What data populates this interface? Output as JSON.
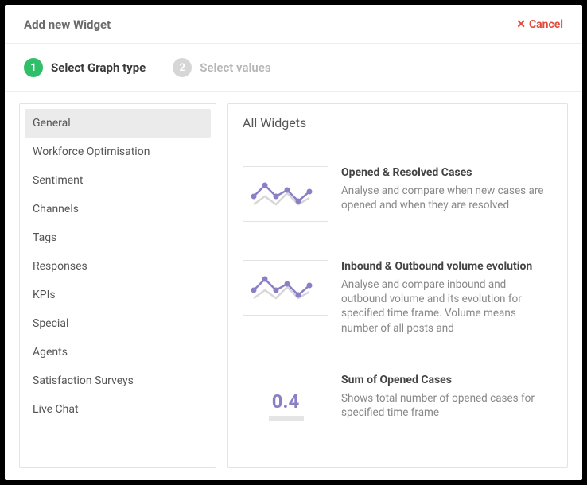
{
  "header": {
    "title": "Add new Widget",
    "cancel": "Cancel"
  },
  "steps": [
    {
      "num": "1",
      "label": "Select Graph type",
      "active": true
    },
    {
      "num": "2",
      "label": "Select values",
      "active": false
    }
  ],
  "sidebar": {
    "items": [
      {
        "label": "General",
        "selected": true
      },
      {
        "label": "Workforce Optimisation",
        "selected": false
      },
      {
        "label": "Sentiment",
        "selected": false
      },
      {
        "label": "Channels",
        "selected": false
      },
      {
        "label": "Tags",
        "selected": false
      },
      {
        "label": "Responses",
        "selected": false
      },
      {
        "label": "KPIs",
        "selected": false
      },
      {
        "label": "Special",
        "selected": false
      },
      {
        "label": "Agents",
        "selected": false
      },
      {
        "label": "Satisfaction Surveys",
        "selected": false
      },
      {
        "label": "Live Chat",
        "selected": false
      }
    ]
  },
  "main": {
    "header": "All Widgets",
    "widgets": [
      {
        "icon": "line-chart",
        "title": "Opened & Resolved Cases",
        "desc": "Analyse and compare when new cases are opened and when they are resolved"
      },
      {
        "icon": "line-chart",
        "title": "Inbound & Outbound volume evolution",
        "desc": "Analyse and compare inbound and outbound volume and its evolution for specified time frame. Volume means number of all posts and"
      },
      {
        "icon": "number",
        "number": "0.4",
        "title": "Sum of Opened Cases",
        "desc": "Shows total number of opened cases for specified time frame"
      }
    ]
  }
}
